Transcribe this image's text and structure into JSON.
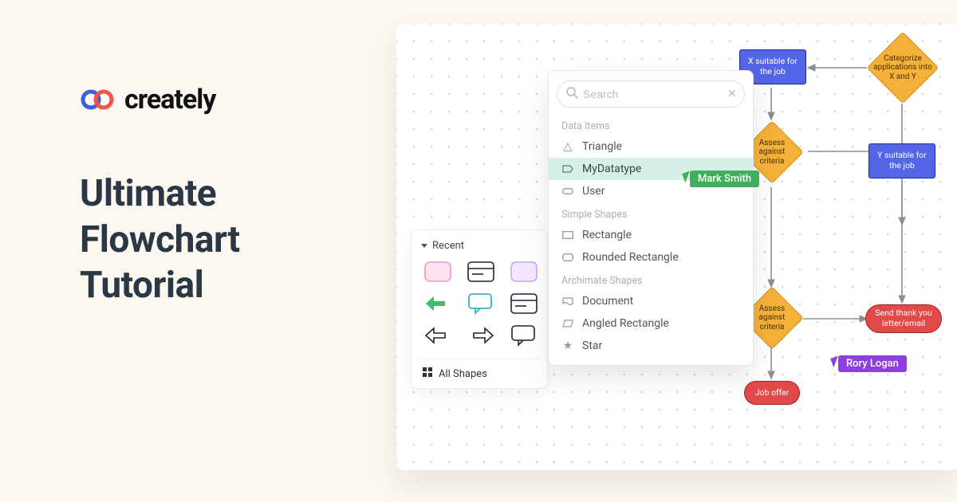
{
  "brand": {
    "name": "creately"
  },
  "headline": "Ultimate Flowchart Tutorial",
  "shapes_panel": {
    "section": "Recent",
    "all_shapes_label": "All Shapes"
  },
  "popover": {
    "search_placeholder": "Search",
    "groups": [
      {
        "label": "Data Items",
        "items": [
          "Triangle",
          "MyDatatype",
          "User"
        ],
        "active_index": 1
      },
      {
        "label": "Simple Shapes",
        "items": [
          "Rectangle",
          "Rounded Rectangle"
        ]
      },
      {
        "label": "Archimate Shapes",
        "items": [
          "Document",
          "Angled Rectangle",
          "Star"
        ]
      }
    ]
  },
  "diagram": {
    "nodes": {
      "x_suitable": "X suitable for the job",
      "categorize": "Categorize applications into X and Y",
      "assess1": "Assess against criteria",
      "y_suitable": "Y suitable for the job",
      "assess2": "Assess against criteria",
      "send_letter": "Send thank you letter/email",
      "job_offer": "Job offer"
    }
  },
  "presence": {
    "user1": "Mark Smith",
    "user2": "Rory Logan"
  }
}
